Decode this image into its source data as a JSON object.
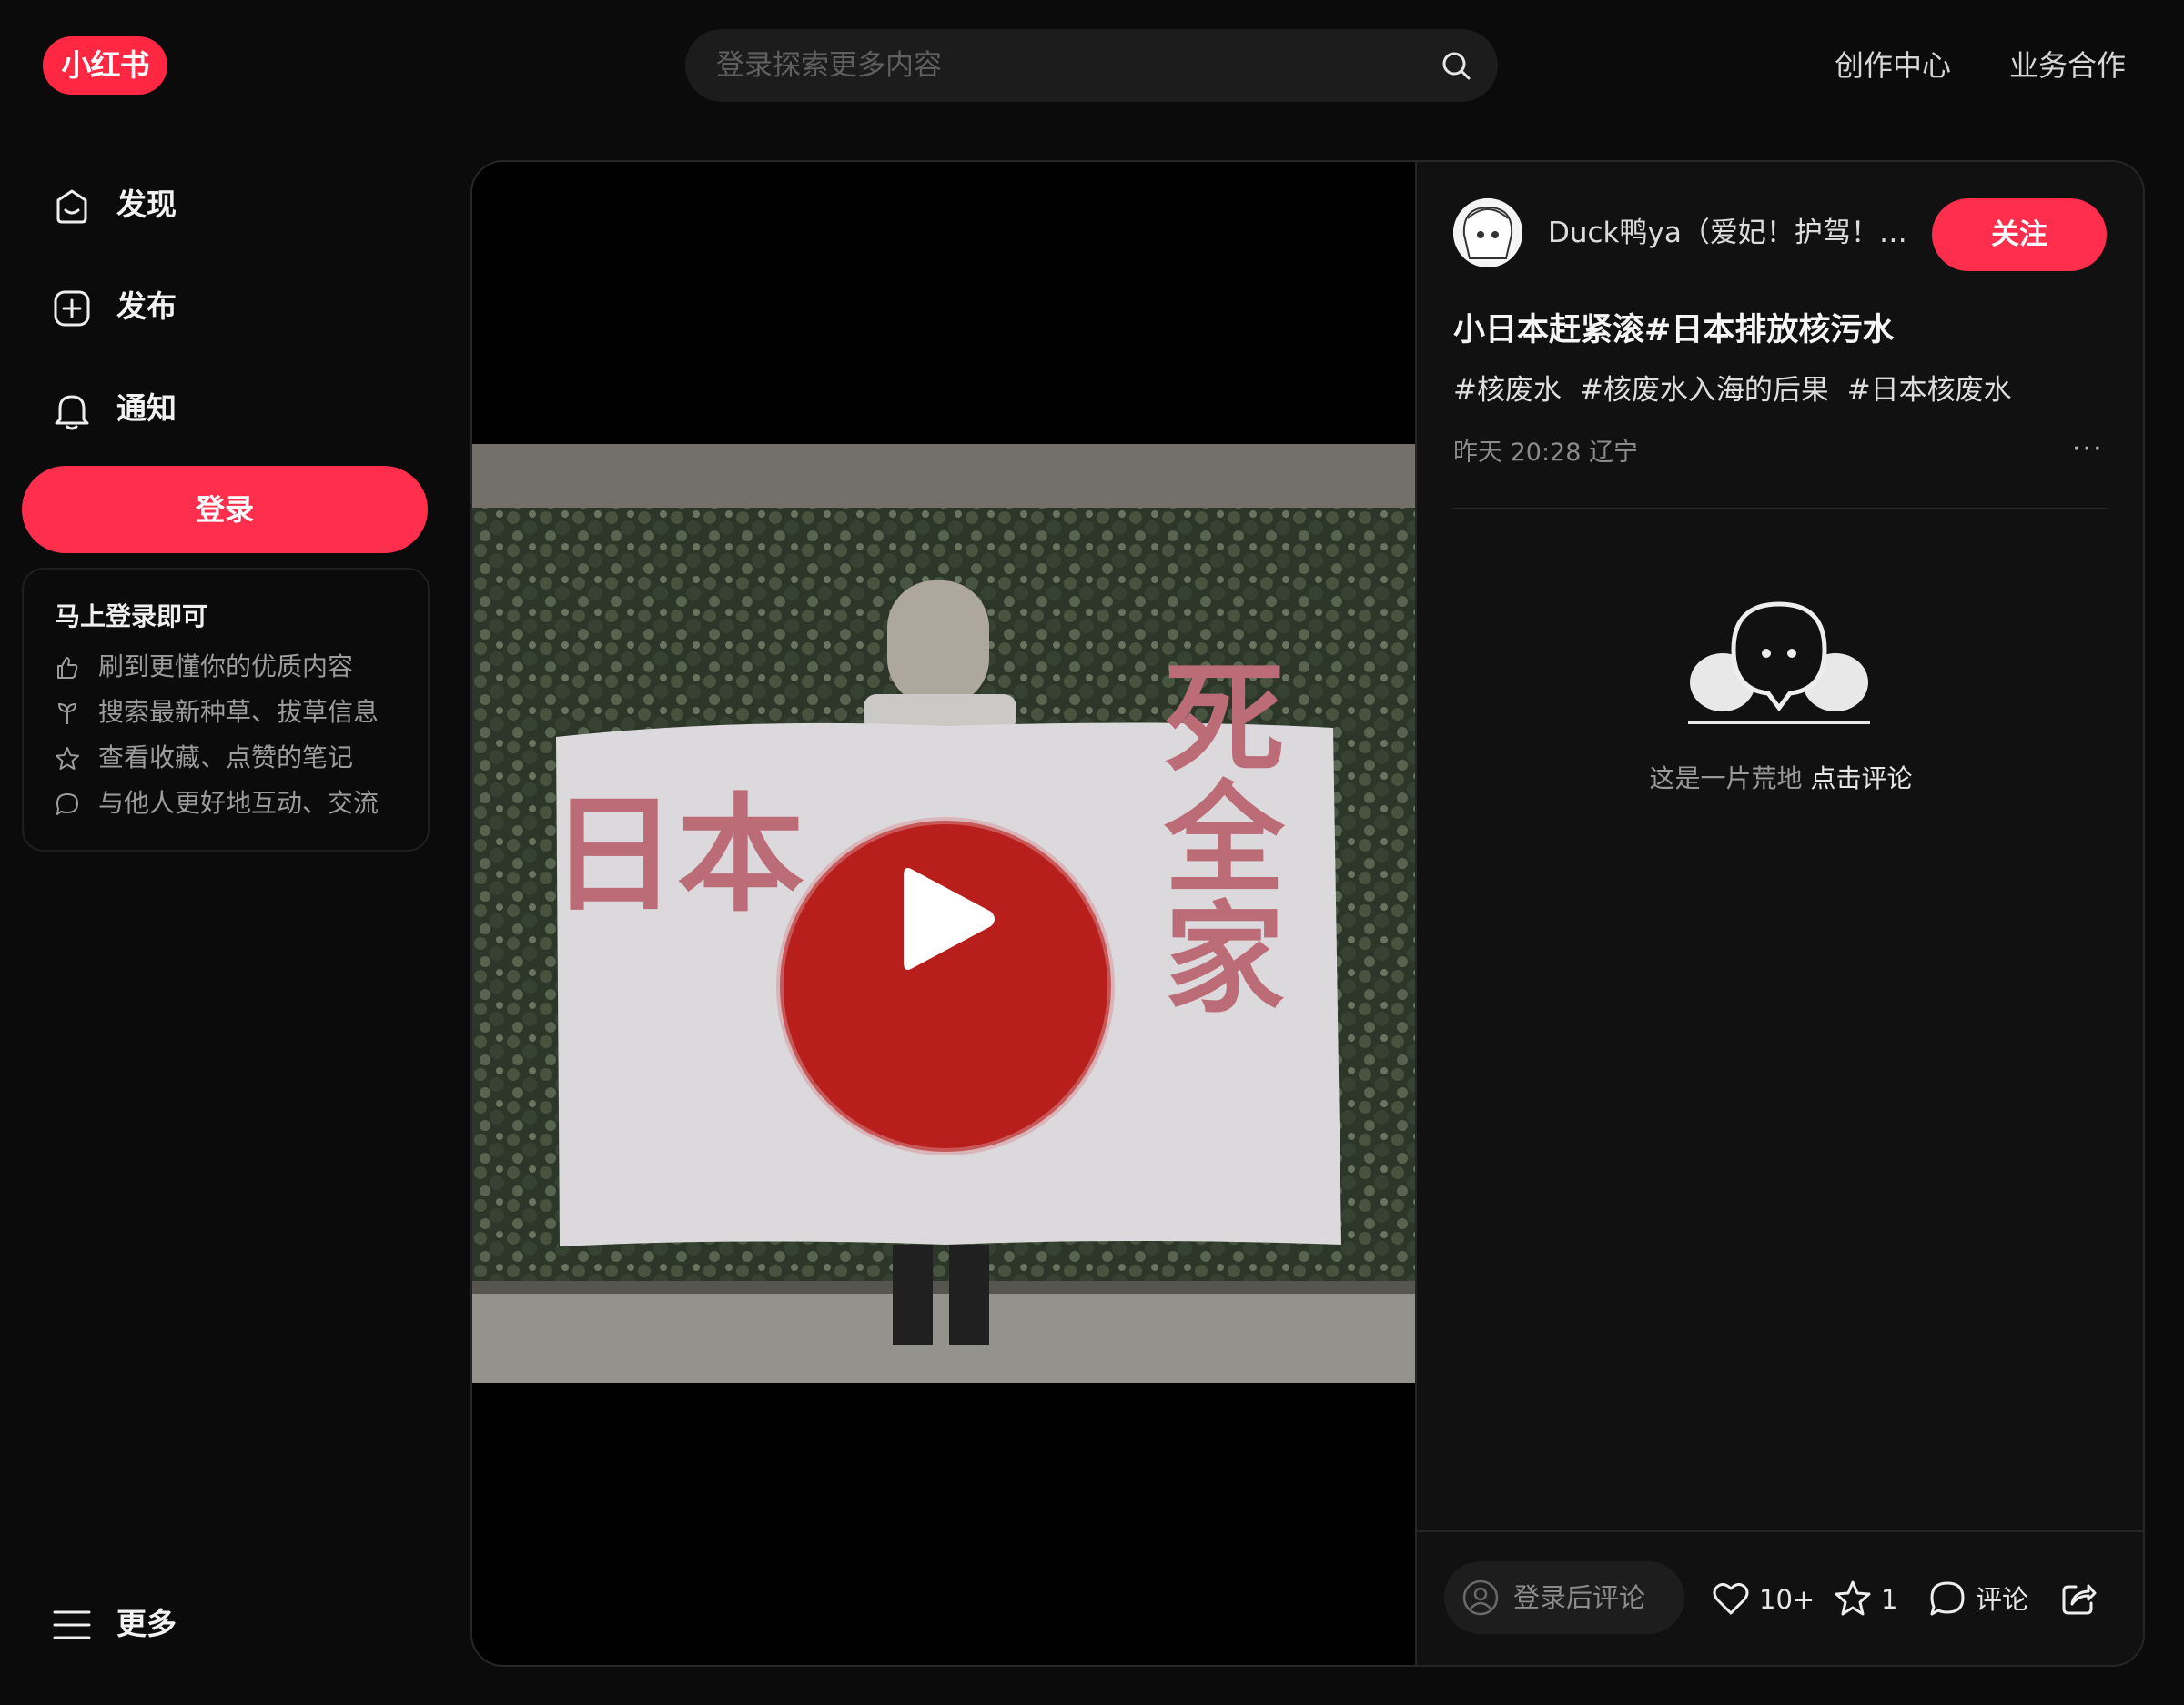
{
  "header": {
    "logo_text": "小红书",
    "search_placeholder": "登录探索更多内容",
    "links": [
      "创作中心",
      "业务合作"
    ]
  },
  "sidebar": {
    "items": [
      {
        "label": "发现",
        "icon": "home-icon"
      },
      {
        "label": "发布",
        "icon": "plus-square-icon"
      },
      {
        "label": "通知",
        "icon": "bell-icon"
      }
    ],
    "login_button": "登录",
    "promo": {
      "title": "马上登录即可",
      "items": [
        {
          "icon": "thumbs-up-icon",
          "text": "刷到更懂你的优质内容"
        },
        {
          "icon": "sprout-icon",
          "text": "搜索最新种草、拔草信息"
        },
        {
          "icon": "star-icon",
          "text": "查看收藏、点赞的笔记"
        },
        {
          "icon": "chat-bubble-icon",
          "text": "与他人更好地互动、交流"
        }
      ]
    },
    "more_label": "更多"
  },
  "post": {
    "media": {
      "type": "video",
      "banner_left_text": "日本",
      "banner_right_text": "死全家"
    },
    "author": "Duck鸭ya（爱妃！护驾！！！）",
    "follow_label": "关注",
    "title": "小日本赶紧滚#日本排放核污水",
    "tags": [
      "#核废水",
      "#核废水入海的后果",
      "#日本核废水"
    ],
    "meta": "昨天 20:28 辽宁",
    "more_menu": "···",
    "empty_comments": {
      "text": "这是一片荒地 ",
      "link": "点击评论"
    },
    "bottom_bar": {
      "comment_placeholder": "登录后评论",
      "likes": "10+",
      "collects": "1",
      "comment_label": "评论"
    }
  },
  "colors": {
    "accent": "#ff2e4d",
    "background": "#0b0b0b",
    "panel": "#111111"
  }
}
